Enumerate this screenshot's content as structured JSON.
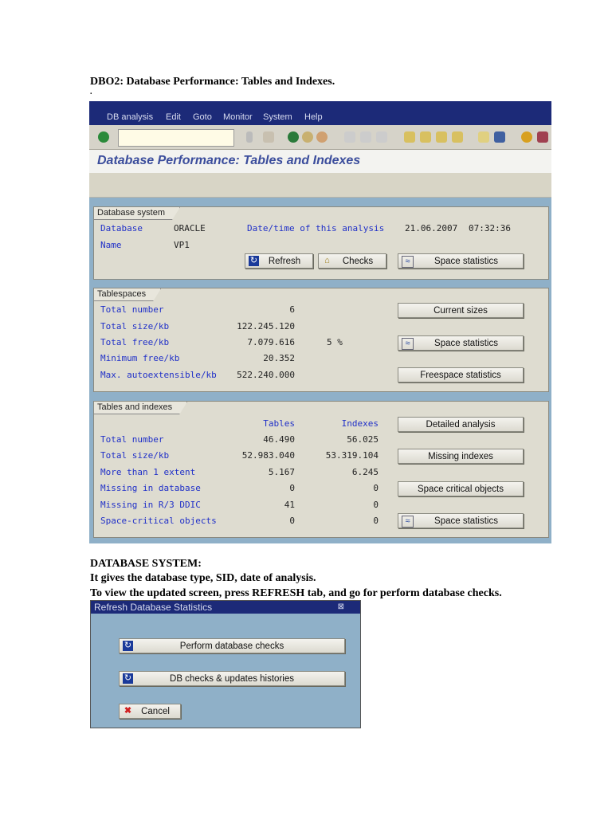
{
  "doc": {
    "heading": "DBO2: Database Performance: Tables and Indexes.",
    "dot": ".",
    "section": "DATABASE SYSTEM:",
    "line1": "It gives the database type, SID, date of analysis.",
    "line2": "To view the updated screen, press REFRESH tab, and go for perform database checks."
  },
  "menu": [
    "DB analysis",
    "Edit",
    "Goto",
    "Monitor",
    "System",
    "Help"
  ],
  "command_field": {
    "value": ""
  },
  "page_title": "Database Performance: Tables and Indexes",
  "dbsys": {
    "title": "Database system",
    "db_label": "Database",
    "db_value": "ORACLE",
    "name_label": "Name",
    "name_value": "VP1",
    "date_label": "Date/time of this analysis",
    "date": "21.06.2007",
    "time": "07:32:36",
    "refresh": "Refresh",
    "checks": "Checks",
    "space": "Space statistics"
  },
  "ts": {
    "title": "Tablespaces",
    "rows": [
      {
        "label": "Total number",
        "value": "6"
      },
      {
        "label": "Total size/kb",
        "value": "122.245.120"
      },
      {
        "label": "Total free/kb",
        "value": "7.079.616",
        "pct": "5 %"
      },
      {
        "label": "Minimum free/kb",
        "value": "20.352"
      },
      {
        "label": "Max. autoextensible/kb",
        "value": "522.240.000"
      }
    ],
    "btn_current": "Current sizes",
    "btn_space": "Space statistics",
    "btn_free": "Freespace statistics"
  },
  "ti": {
    "title": "Tables and indexes",
    "col_tables": "Tables",
    "col_indexes": "Indexes",
    "rows": [
      {
        "label": "Total number",
        "t": "46.490",
        "i": "56.025"
      },
      {
        "label": "Total size/kb",
        "t": "52.983.040",
        "i": "53.319.104"
      },
      {
        "label": "More than 1 extent",
        "t": "5.167",
        "i": "6.245"
      },
      {
        "label": "Missing in database",
        "t": "0",
        "i": "0"
      },
      {
        "label": "Missing in R/3 DDIC",
        "t": "41",
        "i": "0"
      },
      {
        "label": "Space-critical objects",
        "t": "0",
        "i": "0"
      }
    ],
    "btn_detailed": "Detailed analysis",
    "btn_missing": "Missing indexes",
    "btn_critical": "Space critical objects",
    "btn_space": "Space statistics"
  },
  "dialog": {
    "title": "Refresh Database Statistics",
    "btn_perform": "Perform database checks",
    "btn_histories": "DB checks & updates histories",
    "btn_cancel": "Cancel"
  }
}
